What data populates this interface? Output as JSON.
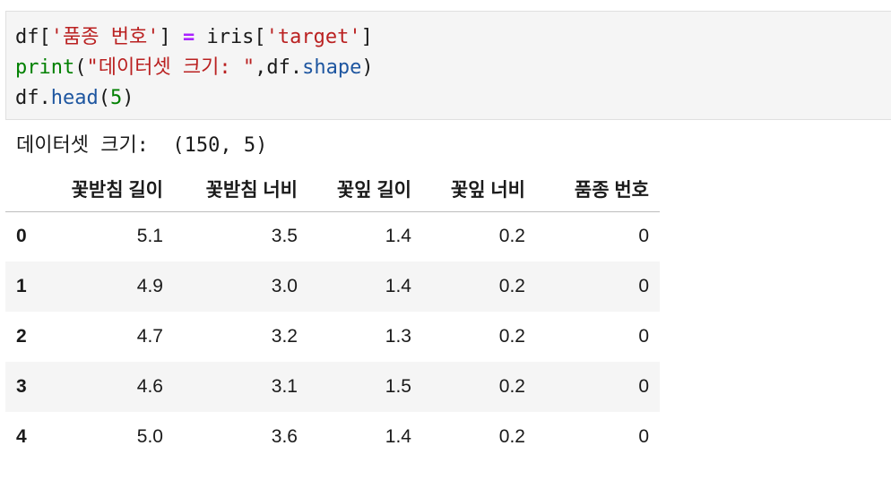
{
  "code_cell": {
    "line1": {
      "df": "df[",
      "str1": "'품종 번호'",
      "close": "] ",
      "op": "=",
      "iris": " iris[",
      "str2": "'target'",
      "end": "]"
    },
    "line2": {
      "print": "print",
      "open": "(",
      "str": "\"데이터셋 크기: \"",
      "comma": ",df.",
      "shape": "shape",
      "close": ")"
    },
    "line3": {
      "df": "df.",
      "head": "head",
      "open": "(",
      "num": "5",
      "close": ")"
    }
  },
  "output": {
    "text": "데이터셋 크기:  (150, 5)"
  },
  "table": {
    "columns": [
      "",
      "꽃받침 길이",
      "꽃받침 너비",
      "꽃잎 길이",
      "꽃잎 너비",
      "품종 번호"
    ],
    "rows": [
      {
        "index": "0",
        "values": [
          "5.1",
          "3.5",
          "1.4",
          "0.2",
          "0"
        ]
      },
      {
        "index": "1",
        "values": [
          "4.9",
          "3.0",
          "1.4",
          "0.2",
          "0"
        ]
      },
      {
        "index": "2",
        "values": [
          "4.7",
          "3.2",
          "1.3",
          "0.2",
          "0"
        ]
      },
      {
        "index": "3",
        "values": [
          "4.6",
          "3.1",
          "1.5",
          "0.2",
          "0"
        ]
      },
      {
        "index": "4",
        "values": [
          "5.0",
          "3.6",
          "1.4",
          "0.2",
          "0"
        ]
      }
    ]
  }
}
